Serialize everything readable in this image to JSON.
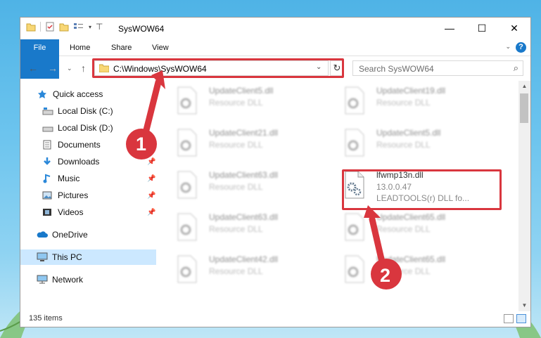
{
  "window": {
    "title": "SysWOW64",
    "controls": {
      "minimize": "—",
      "maximize": "☐",
      "close": "✕"
    }
  },
  "ribbon": {
    "tabs": [
      "File",
      "Home",
      "Share",
      "View"
    ],
    "help": "?"
  },
  "address": {
    "path": "C:\\Windows\\SysWOW64",
    "search_placeholder": "Search SysWOW64"
  },
  "sidebar": {
    "items": [
      {
        "label": "Quick access",
        "icon": "star-icon",
        "pinned": false
      },
      {
        "label": "Local Disk (C:)",
        "icon": "drive-icon",
        "pinned": false
      },
      {
        "label": "Local Disk (D:)",
        "icon": "drive-icon",
        "pinned": false
      },
      {
        "label": "Documents",
        "icon": "documents-icon",
        "pinned": true
      },
      {
        "label": "Downloads",
        "icon": "download-icon",
        "pinned": true
      },
      {
        "label": "Music",
        "icon": "music-icon",
        "pinned": true
      },
      {
        "label": "Pictures",
        "icon": "pictures-icon",
        "pinned": true
      },
      {
        "label": "Videos",
        "icon": "videos-icon",
        "pinned": true
      },
      {
        "label": "OneDrive",
        "icon": "cloud-icon",
        "pinned": false
      },
      {
        "label": "This PC",
        "icon": "computer-icon",
        "pinned": false,
        "selected": true
      },
      {
        "label": "Network",
        "icon": "network-icon",
        "pinned": false
      }
    ]
  },
  "files": [
    {
      "name": "UpdateClient5.dll",
      "desc": "Resource DLL"
    },
    {
      "name": "UpdateClient19.dll",
      "desc": "Resource DLL"
    },
    {
      "name": "UpdateClient21.dll",
      "desc": "Resource DLL"
    },
    {
      "name": "UpdateClient5.dll",
      "desc": "Resource DLL"
    },
    {
      "name": "UpdateClient63.dll",
      "desc": "Resource DLL"
    },
    {
      "name": "lfwmp13n.dll",
      "desc": "13.0.0.47",
      "desc2": "LEADTOOLS(r) DLL fo...",
      "highlighted": true
    },
    {
      "name": "UpdateClient63.dll",
      "desc": "Resource DLL"
    },
    {
      "name": "UpdateClient65.dll",
      "desc": "Resource DLL"
    },
    {
      "name": "UpdateClient42.dll",
      "desc": "Resource DLL"
    },
    {
      "name": "UpdateClient65.dll",
      "desc": "Resource DLL"
    }
  ],
  "status": {
    "items": "135 items"
  },
  "callouts": [
    "1",
    "2"
  ],
  "colors": {
    "accent": "#1979ca",
    "highlight": "#d9363e",
    "selected": "#cce8ff"
  }
}
